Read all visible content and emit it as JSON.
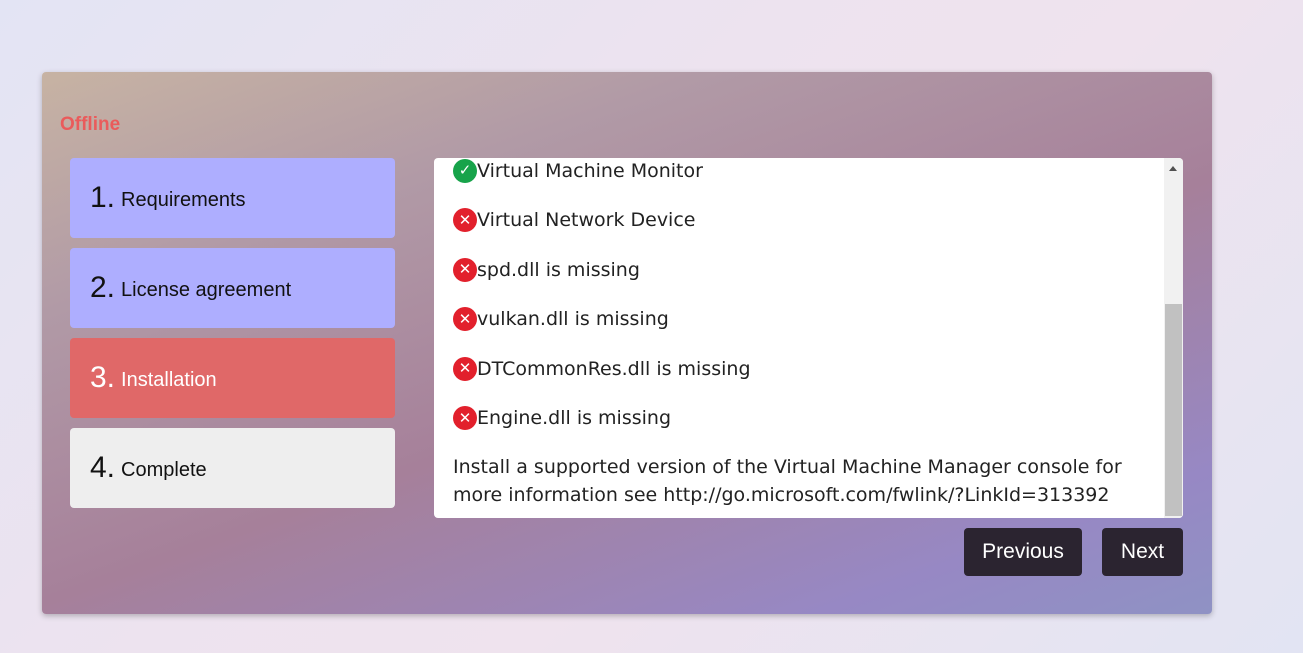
{
  "status": "Offline",
  "steps": [
    {
      "num": "1.",
      "label": "Requirements",
      "state": "pending"
    },
    {
      "num": "2.",
      "label": "License agreement",
      "state": "pending"
    },
    {
      "num": "3.",
      "label": "Installation",
      "state": "active"
    },
    {
      "num": "4.",
      "label": "Complete",
      "state": "later"
    }
  ],
  "requirements": [
    {
      "text": "Virtual Machine Monitor",
      "icon": "check-circle-icon"
    },
    {
      "text": "Virtual Network Device",
      "icon": "error-circle-icon"
    },
    {
      "text": "spd.dll is missing",
      "icon": "error-circle-icon"
    },
    {
      "text": "vulkan.dll is missing",
      "icon": "error-circle-icon"
    },
    {
      "text": "DTCommonRes.dll is missing",
      "icon": "error-circle-icon"
    },
    {
      "text": "Engine.dll is missing",
      "icon": "error-circle-icon"
    }
  ],
  "note": "Install a supported version of the Virtual Machine Manager console for more information see http://go.microsoft.com/fwlink/?LinkId=313392",
  "buttons": {
    "previous": "Previous",
    "next": "Next"
  },
  "colors": {
    "status": "#ea5b5b",
    "step_pending": "#aeaeff",
    "step_active": "#e06868",
    "step_later": "#eeeeee",
    "ok": "#17a34a",
    "error": "#e2202c",
    "button": "#2b2430"
  }
}
